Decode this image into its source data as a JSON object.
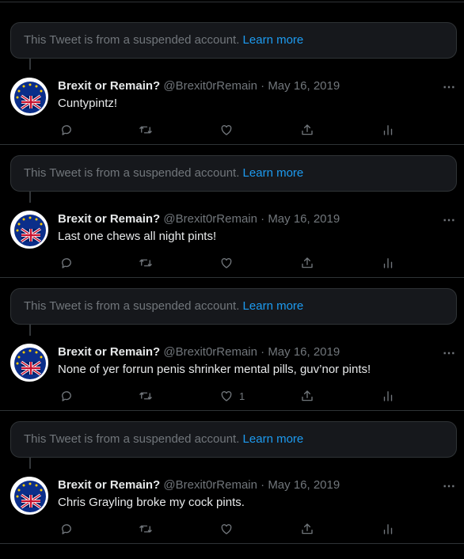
{
  "colors": {
    "background": "#000000",
    "divider": "#2f3336",
    "link": "#1d9bf0",
    "muted": "#71767b",
    "text": "#e7e9ea"
  },
  "icons": [
    "reply-icon",
    "retweet-icon",
    "like-icon",
    "share-icon",
    "analytics-icon",
    "more-icon"
  ],
  "groups": [
    {
      "notice": {
        "text": "This Tweet is from a suspended account.",
        "link": "Learn more"
      },
      "tweet": {
        "name": "Brexit or Remain?",
        "handle": "@Brexit0rRemain",
        "separator": "·",
        "date": "May 16, 2019",
        "text": "Cuntypintz!",
        "likes": ""
      }
    },
    {
      "notice": {
        "text": "This Tweet is from a suspended account.",
        "link": "Learn more"
      },
      "tweet": {
        "name": "Brexit or Remain?",
        "handle": "@Brexit0rRemain",
        "separator": "·",
        "date": "May 16, 2019",
        "text": "Last one chews all night pints!",
        "likes": ""
      }
    },
    {
      "notice": {
        "text": "This Tweet is from a suspended account.",
        "link": "Learn more"
      },
      "tweet": {
        "name": "Brexit or Remain?",
        "handle": "@Brexit0rRemain",
        "separator": "·",
        "date": "May 16, 2019",
        "text": "None of yer forrun penis shrinker mental pills, guv’nor pints!",
        "likes": "1"
      }
    },
    {
      "notice": {
        "text": "This Tweet is from a suspended account.",
        "link": "Learn more"
      },
      "tweet": {
        "name": "Brexit or Remain?",
        "handle": "@Brexit0rRemain",
        "separator": "·",
        "date": "May 16, 2019",
        "text": "Chris Grayling broke my cock pints.",
        "likes": ""
      }
    }
  ]
}
